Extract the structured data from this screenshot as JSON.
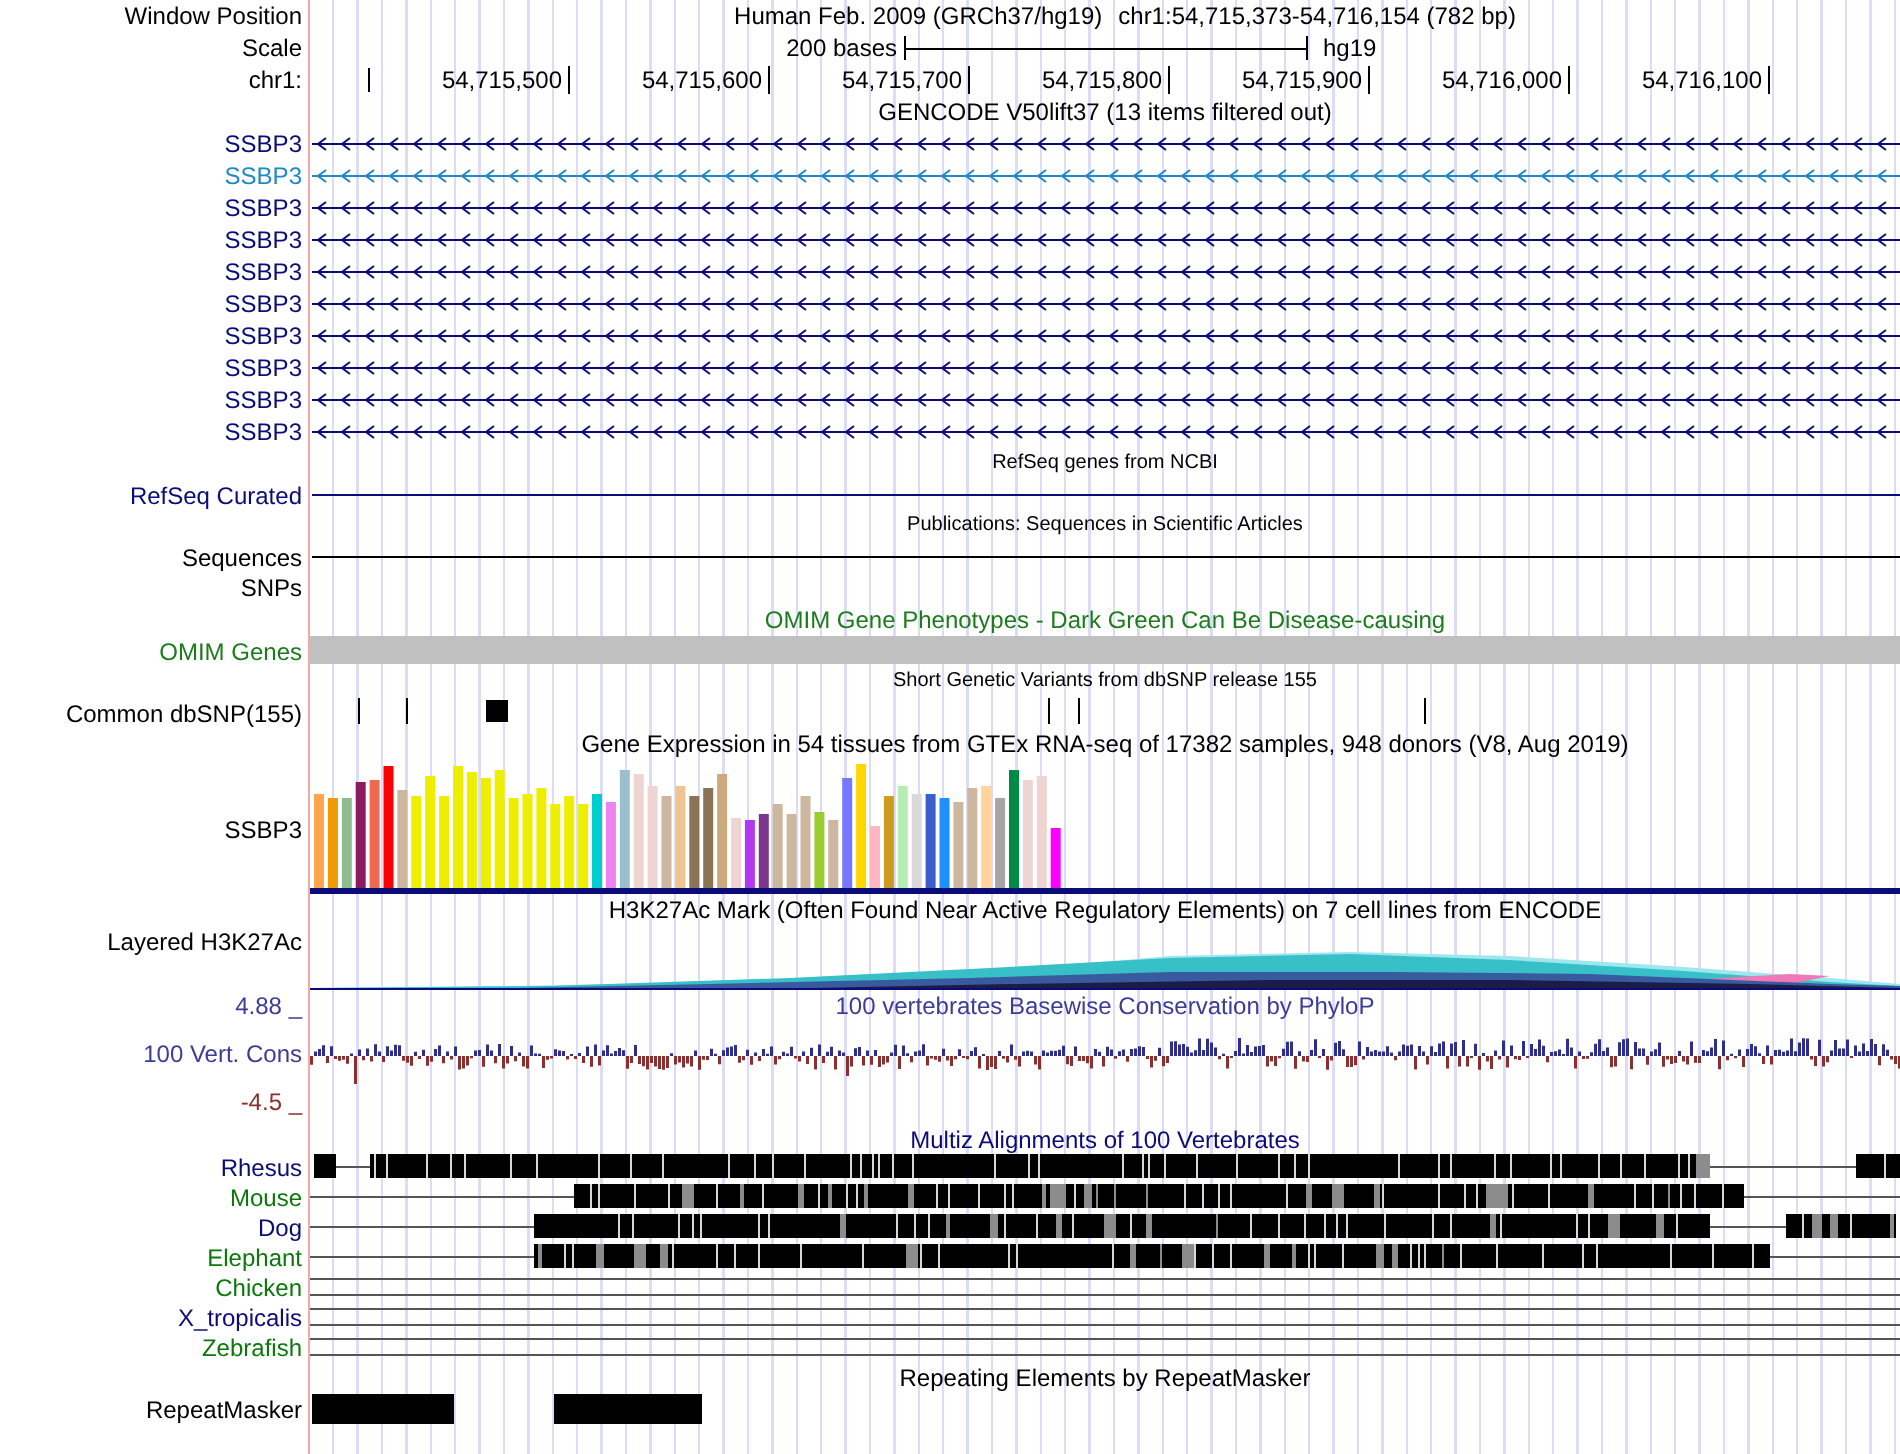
{
  "position": {
    "label": "Window Position",
    "assembly": "Human Feb. 2009 (GRCh37/hg19)",
    "region": "chr1:54,715,373-54,716,154 (782 bp)"
  },
  "scale": {
    "label": "Scale",
    "length": "200 bases",
    "assembly": "hg19"
  },
  "ruler": {
    "label": "chr1:",
    "ticks": [
      "54,715,500",
      "54,715,600",
      "54,715,700",
      "54,715,800",
      "54,715,900",
      "54,716,000",
      "54,716,100"
    ]
  },
  "gencode": {
    "title": "GENCODE V50lift37 (13 items filtered out)",
    "items": [
      {
        "name": "SSBP3",
        "color": "#0c0c78"
      },
      {
        "name": "SSBP3",
        "color": "#1e88c8"
      },
      {
        "name": "SSBP3",
        "color": "#0c0c78"
      },
      {
        "name": "SSBP3",
        "color": "#0c0c78"
      },
      {
        "name": "SSBP3",
        "color": "#0c0c78"
      },
      {
        "name": "SSBP3",
        "color": "#0c0c78"
      },
      {
        "name": "SSBP3",
        "color": "#0c0c78"
      },
      {
        "name": "SSBP3",
        "color": "#0c0c78"
      },
      {
        "name": "SSBP3",
        "color": "#0c0c78"
      },
      {
        "name": "SSBP3",
        "color": "#0c0c78"
      }
    ]
  },
  "refseq": {
    "title": "RefSeq genes from NCBI",
    "label": "RefSeq Curated"
  },
  "publications": {
    "title": "Publications: Sequences in Scientific Articles",
    "label": "Sequences"
  },
  "snps": {
    "label": "SNPs"
  },
  "omim": {
    "title": "OMIM Gene Phenotypes - Dark Green Can Be Disease-causing",
    "label": "OMIM Genes"
  },
  "dbsnp": {
    "title": "Short Genetic Variants from dbSNP release 155",
    "label": "Common dbSNP(155)"
  },
  "gtex": {
    "title": "Gene Expression in 54 tissues from GTEx RNA-seq of 17382 samples, 948 donors (V8, Aug 2019)",
    "label": "SSBP3"
  },
  "h3k27ac": {
    "title": "H3K27Ac Mark (Often Found Near Active Regulatory Elements) on 7 cell lines from ENCODE",
    "label": "Layered H3K27Ac"
  },
  "conservation": {
    "title": "100 vertebrates Basewise Conservation by PhyloP",
    "label": "100 Vert. Cons",
    "max": "4.88 _",
    "min": "-4.5 _"
  },
  "multiz": {
    "title": "Multiz Alignments of 100 Vertebrates",
    "species": [
      {
        "name": "Rhesus",
        "color": "#0c0c78"
      },
      {
        "name": "Mouse",
        "color": "#0c780c"
      },
      {
        "name": "Dog",
        "color": "#0c0c78"
      },
      {
        "name": "Elephant",
        "color": "#0c780c"
      },
      {
        "name": "Chicken",
        "color": "#0c780c"
      },
      {
        "name": "X_tropicalis",
        "color": "#0c0c78"
      },
      {
        "name": "Zebrafish",
        "color": "#0c780c"
      }
    ]
  },
  "repeatmasker": {
    "title": "Repeating Elements by RepeatMasker",
    "label": "RepeatMasker"
  }
}
